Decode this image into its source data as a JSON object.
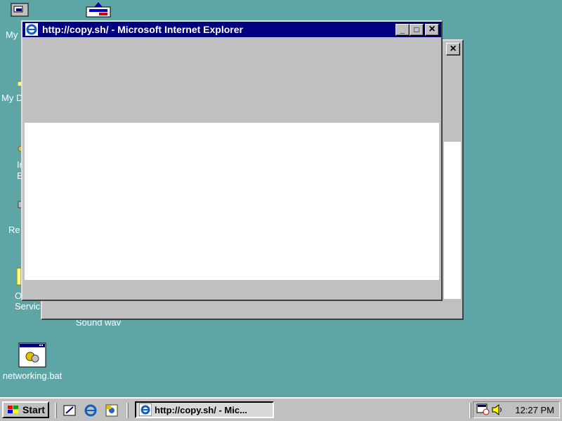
{
  "desktop": {
    "background": "#5ea6a6",
    "icons": [
      {
        "label": "My"
      },
      {
        "label": "My D"
      },
      {
        "label": "In\nE"
      },
      {
        "label": "Re"
      },
      {
        "label": "Onlin\nServic"
      },
      {
        "label": "Sound wav"
      },
      {
        "label": "networking.bat"
      }
    ]
  },
  "back_window": {
    "close_glyph": "×"
  },
  "ie_window": {
    "title": "http://copy.sh/ - Microsoft Internet Explorer",
    "icon": "internet-explorer-icon",
    "buttons": {
      "minimize": "_",
      "maximize": "□",
      "close": "×"
    }
  },
  "taskbar": {
    "start_label": "Start",
    "quick_launch": [
      "show-desktop-icon",
      "internet-explorer-icon",
      "outlook-express-icon"
    ],
    "task_label": "http://copy.sh/ - Mic...",
    "clock": "12:27 PM",
    "tray_icons": [
      "scheduler-icon",
      "volume-icon"
    ]
  }
}
